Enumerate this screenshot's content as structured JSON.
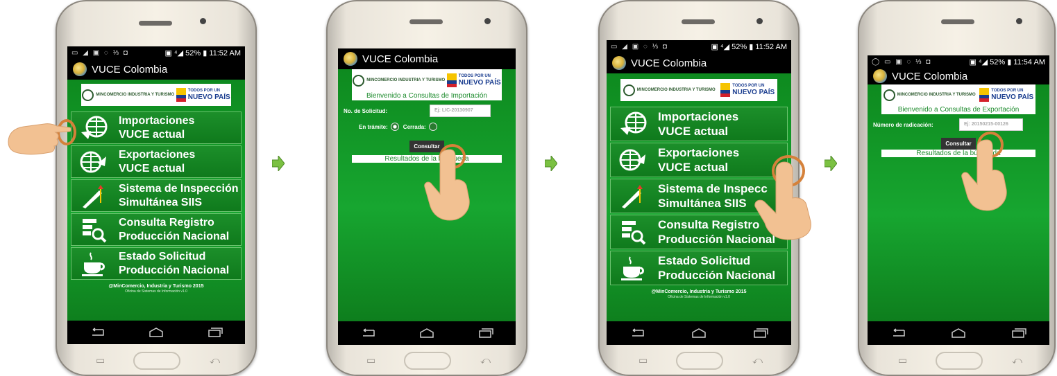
{
  "app": {
    "title": "VUCE Colombia",
    "banner_left": "MINCOMERCIO INDUSTRIA Y TURISMO",
    "banner_right_small": "TODOS POR UN",
    "banner_right_big": "NUEVO PAÍS"
  },
  "status": {
    "p1": {
      "left": "▭ ◢ ▣ ◌ ⅓ ◘",
      "right": "▣ ⁴◢ 52% ▮ 11:52 AM"
    },
    "p3": {
      "left": "▭ ◢ ▣ ◌ ⅓ ◘",
      "right": "▣ ⁴◢ 52% ▮ 11:52 AM"
    },
    "p4": {
      "left": "◯ ▭ ▣ ◌ ⅓ ◘",
      "right": "▣ ⁴◢ 52% ▮ 11:54 AM"
    }
  },
  "menu": [
    {
      "line1": "Importaciones",
      "line2": "VUCE actual",
      "icon": "globe-arrow-in-icon"
    },
    {
      "line1": "Exportaciones",
      "line2": "VUCE actual",
      "icon": "globe-arrow-out-icon"
    },
    {
      "line1": "Sistema de Inspección",
      "line2": "Simultánea SIIS",
      "icon": "inspection-icon"
    },
    {
      "line1": "Consulta Registro",
      "line2": "Producción Nacional",
      "icon": "registry-search-icon"
    },
    {
      "line1": "Estado Solicitud",
      "line2": "Producción Nacional",
      "icon": "coffee-cup-icon"
    }
  ],
  "menu_p3": [
    {
      "line1": "Importaciones",
      "line2": "VUCE actual"
    },
    {
      "line1": "Exportaciones",
      "line2": "VUCE actual"
    },
    {
      "line1": "Sistema de Inspecc",
      "line2": "Simultánea SIIS"
    },
    {
      "line1": "Consulta Registro",
      "line2": "Producción Nacional"
    },
    {
      "line1": "Estado Solicitud",
      "line2": "Producción Nacional"
    }
  ],
  "footer": {
    "copyright": "@MinComercio, Industria y Turismo 2015",
    "sub": "Oficina de Sistemas de Información v1.0"
  },
  "import_screen": {
    "welcome": "Bienvenido a Consultas de Importación",
    "solicitud_label": "No. de Solicitud:",
    "solicitud_placeholder": "Ej: LIC-20130907",
    "en_tramite": "En trámite:",
    "cerrada": "Cerrada:",
    "consultar": "Consultar",
    "results": "Resultados de la búsqueda"
  },
  "export_screen": {
    "welcome": "Bienvenido a Consultas de Exportación",
    "radicacion_label": "Número de radicación:",
    "radicacion_placeholder": "Ej: 20150215-00126",
    "consultar": "Consultar",
    "results": "Resultados de la búsqueda"
  },
  "colors": {
    "accent_green": "#17a630",
    "hand": "#f2c192",
    "ring": "#d5813a",
    "arrow": "#7bc142"
  }
}
